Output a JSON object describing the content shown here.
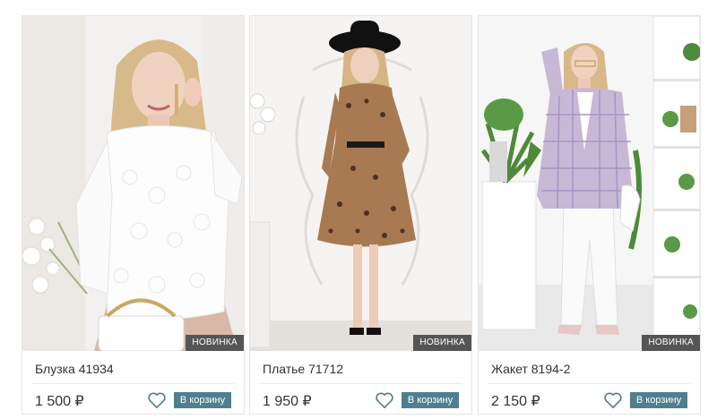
{
  "products": [
    {
      "title": "Блузка 41934",
      "price": "1 500 ₽",
      "badge": "НОВИНКА",
      "cart_label": "В корзину",
      "image": "blouse-photo"
    },
    {
      "title": "Платье 71712",
      "price": "1 950 ₽",
      "badge": "НОВИНКА",
      "cart_label": "В корзину",
      "image": "leopard-dress-photo"
    },
    {
      "title": "Жакет 8194-2",
      "price": "2 150 ₽",
      "badge": "НОВИНКА",
      "cart_label": "В корзину",
      "image": "plaid-jacket-photo"
    }
  ],
  "icons": {
    "favorite": "heart-outline-icon"
  },
  "colors": {
    "cart_button": "#4f7f8f",
    "badge_bg": "#555555",
    "heart": "#4f7f8f"
  }
}
